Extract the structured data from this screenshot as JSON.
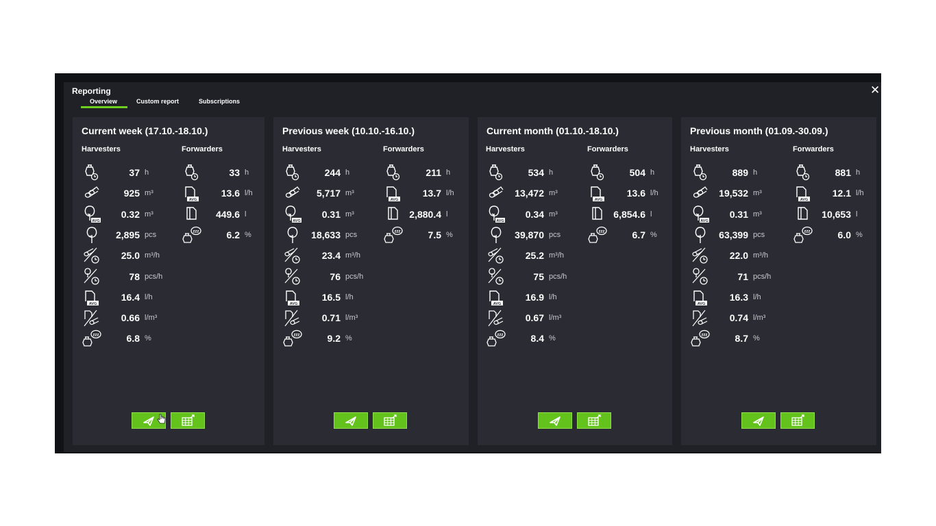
{
  "window": {
    "title": "Reporting",
    "tabs": [
      {
        "label": "Overview",
        "active": true
      },
      {
        "label": "Custom report",
        "active": false
      },
      {
        "label": "Subscriptions",
        "active": false
      }
    ],
    "close_label": "✕"
  },
  "colors": {
    "accent": "#6fcf1e",
    "panel": "#2b2c33",
    "background": "#202127",
    "button": "#63c21b"
  },
  "panels": [
    {
      "title": "Current week (17.10.-18.10.)",
      "harvesters_label": "Harvesters",
      "forwarders_label": "Forwarders",
      "harvesters": [
        {
          "icon": "engine-hours-icon",
          "value": "37",
          "unit": "h"
        },
        {
          "icon": "logs-volume-icon",
          "value": "925",
          "unit": "m³"
        },
        {
          "icon": "avg-tree-volume-icon",
          "value": "0.32",
          "unit": "m³"
        },
        {
          "icon": "tree-count-icon",
          "value": "2,895",
          "unit": "pcs"
        },
        {
          "icon": "volume-per-hour-icon",
          "value": "25.0",
          "unit": "m³/h"
        },
        {
          "icon": "trees-per-hour-icon",
          "value": "78",
          "unit": "pcs/h"
        },
        {
          "icon": "avg-fuel-rate-icon",
          "value": "16.4",
          "unit": "l/h"
        },
        {
          "icon": "fuel-per-volume-icon",
          "value": "0.66",
          "unit": "l/m³"
        },
        {
          "icon": "idle-engine-icon",
          "value": "6.8",
          "unit": "%"
        }
      ],
      "forwarders": [
        {
          "icon": "engine-hours-icon",
          "value": "33",
          "unit": "h"
        },
        {
          "icon": "avg-fuel-rate-icon",
          "value": "13.6",
          "unit": "l/h"
        },
        {
          "icon": "fuel-total-icon",
          "value": "449.6",
          "unit": "l"
        },
        {
          "icon": "idle-engine-icon",
          "value": "6.2",
          "unit": "%"
        }
      ]
    },
    {
      "title": "Previous week (10.10.-16.10.)",
      "harvesters_label": "Harvesters",
      "forwarders_label": "Forwarders",
      "harvesters": [
        {
          "icon": "engine-hours-icon",
          "value": "244",
          "unit": "h"
        },
        {
          "icon": "logs-volume-icon",
          "value": "5,717",
          "unit": "m³"
        },
        {
          "icon": "avg-tree-volume-icon",
          "value": "0.31",
          "unit": "m³"
        },
        {
          "icon": "tree-count-icon",
          "value": "18,633",
          "unit": "pcs"
        },
        {
          "icon": "volume-per-hour-icon",
          "value": "23.4",
          "unit": "m³/h"
        },
        {
          "icon": "trees-per-hour-icon",
          "value": "76",
          "unit": "pcs/h"
        },
        {
          "icon": "avg-fuel-rate-icon",
          "value": "16.5",
          "unit": "l/h"
        },
        {
          "icon": "fuel-per-volume-icon",
          "value": "0.71",
          "unit": "l/m³"
        },
        {
          "icon": "idle-engine-icon",
          "value": "9.2",
          "unit": "%"
        }
      ],
      "forwarders": [
        {
          "icon": "engine-hours-icon",
          "value": "211",
          "unit": "h"
        },
        {
          "icon": "avg-fuel-rate-icon",
          "value": "13.7",
          "unit": "l/h"
        },
        {
          "icon": "fuel-total-icon",
          "value": "2,880.4",
          "unit": "l"
        },
        {
          "icon": "idle-engine-icon",
          "value": "7.5",
          "unit": "%"
        }
      ]
    },
    {
      "title": "Current month (01.10.-18.10.)",
      "harvesters_label": "Harvesters",
      "forwarders_label": "Forwarders",
      "harvesters": [
        {
          "icon": "engine-hours-icon",
          "value": "534",
          "unit": "h"
        },
        {
          "icon": "logs-volume-icon",
          "value": "13,472",
          "unit": "m³"
        },
        {
          "icon": "avg-tree-volume-icon",
          "value": "0.34",
          "unit": "m³"
        },
        {
          "icon": "tree-count-icon",
          "value": "39,870",
          "unit": "pcs"
        },
        {
          "icon": "volume-per-hour-icon",
          "value": "25.2",
          "unit": "m³/h"
        },
        {
          "icon": "trees-per-hour-icon",
          "value": "75",
          "unit": "pcs/h"
        },
        {
          "icon": "avg-fuel-rate-icon",
          "value": "16.9",
          "unit": "l/h"
        },
        {
          "icon": "fuel-per-volume-icon",
          "value": "0.67",
          "unit": "l/m³"
        },
        {
          "icon": "idle-engine-icon",
          "value": "8.4",
          "unit": "%"
        }
      ],
      "forwarders": [
        {
          "icon": "engine-hours-icon",
          "value": "504",
          "unit": "h"
        },
        {
          "icon": "avg-fuel-rate-icon",
          "value": "13.6",
          "unit": "l/h"
        },
        {
          "icon": "fuel-total-icon",
          "value": "6,854.6",
          "unit": "l"
        },
        {
          "icon": "idle-engine-icon",
          "value": "6.7",
          "unit": "%"
        }
      ]
    },
    {
      "title": "Previous month (01.09.-30.09.)",
      "harvesters_label": "Harvesters",
      "forwarders_label": "Forwarders",
      "harvesters": [
        {
          "icon": "engine-hours-icon",
          "value": "889",
          "unit": "h"
        },
        {
          "icon": "logs-volume-icon",
          "value": "19,532",
          "unit": "m³"
        },
        {
          "icon": "avg-tree-volume-icon",
          "value": "0.31",
          "unit": "m³"
        },
        {
          "icon": "tree-count-icon",
          "value": "63,399",
          "unit": "pcs"
        },
        {
          "icon": "volume-per-hour-icon",
          "value": "22.0",
          "unit": "m³/h"
        },
        {
          "icon": "trees-per-hour-icon",
          "value": "71",
          "unit": "pcs/h"
        },
        {
          "icon": "avg-fuel-rate-icon",
          "value": "16.3",
          "unit": "l/h"
        },
        {
          "icon": "fuel-per-volume-icon",
          "value": "0.74",
          "unit": "l/m³"
        },
        {
          "icon": "idle-engine-icon",
          "value": "8.7",
          "unit": "%"
        }
      ],
      "forwarders": [
        {
          "icon": "engine-hours-icon",
          "value": "881",
          "unit": "h"
        },
        {
          "icon": "avg-fuel-rate-icon",
          "value": "12.1",
          "unit": "l/h"
        },
        {
          "icon": "fuel-total-icon",
          "value": "10,653",
          "unit": "l"
        },
        {
          "icon": "idle-engine-icon",
          "value": "6.0",
          "unit": "%"
        }
      ]
    }
  ],
  "buttons": [
    {
      "name": "send-button",
      "icon": "send-icon"
    },
    {
      "name": "export-spreadsheet-button",
      "icon": "spreadsheet-export-icon"
    }
  ]
}
